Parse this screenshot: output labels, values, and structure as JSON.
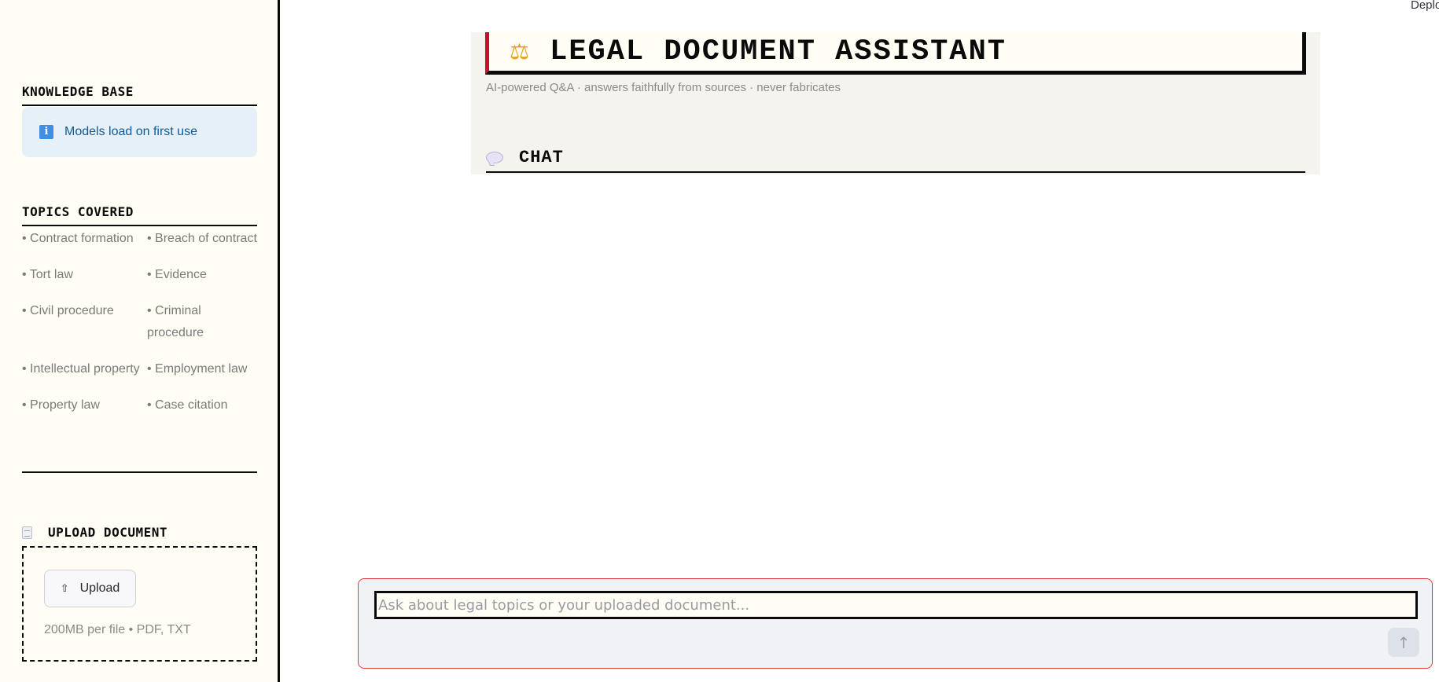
{
  "sidebar": {
    "knowledge_base": {
      "heading": "KNOWLEDGE BASE",
      "info_text": "Models load on first use",
      "info_icon": "info-icon"
    },
    "topics": {
      "heading": "TOPICS COVERED",
      "items": [
        "Contract formation",
        "Breach of contract",
        "Tort law",
        "Evidence",
        "Civil procedure",
        "Criminal procedure",
        "Intellectual property",
        "Employment law",
        "Property law",
        "Case citation"
      ]
    },
    "upload": {
      "heading": "UPLOAD DOCUMENT",
      "heading_icon": "document-icon",
      "button_label": "Upload",
      "button_icon": "upload-icon",
      "limits": "200MB per file • PDF, TXT"
    }
  },
  "header": {
    "deploy_label": "Deploy"
  },
  "main": {
    "title": "LEGAL DOCUMENT ASSISTANT",
    "title_icon": "scales-icon",
    "subtitle": "AI-powered Q&A · answers faithfully from sources · never fabricates",
    "chat_heading": "CHAT",
    "chat_icon": "speech-bubble-icon"
  },
  "chat_input": {
    "placeholder": "Ask about legal topics or your uploaded document...",
    "value": "",
    "send_icon": "arrow-up-icon"
  },
  "colors": {
    "accent_red": "#c8102e",
    "sidebar_bg": "#fffdf4",
    "info_bg": "#e5f0f9",
    "info_text": "#0d5a9c",
    "ink": "#0a0a0a"
  }
}
